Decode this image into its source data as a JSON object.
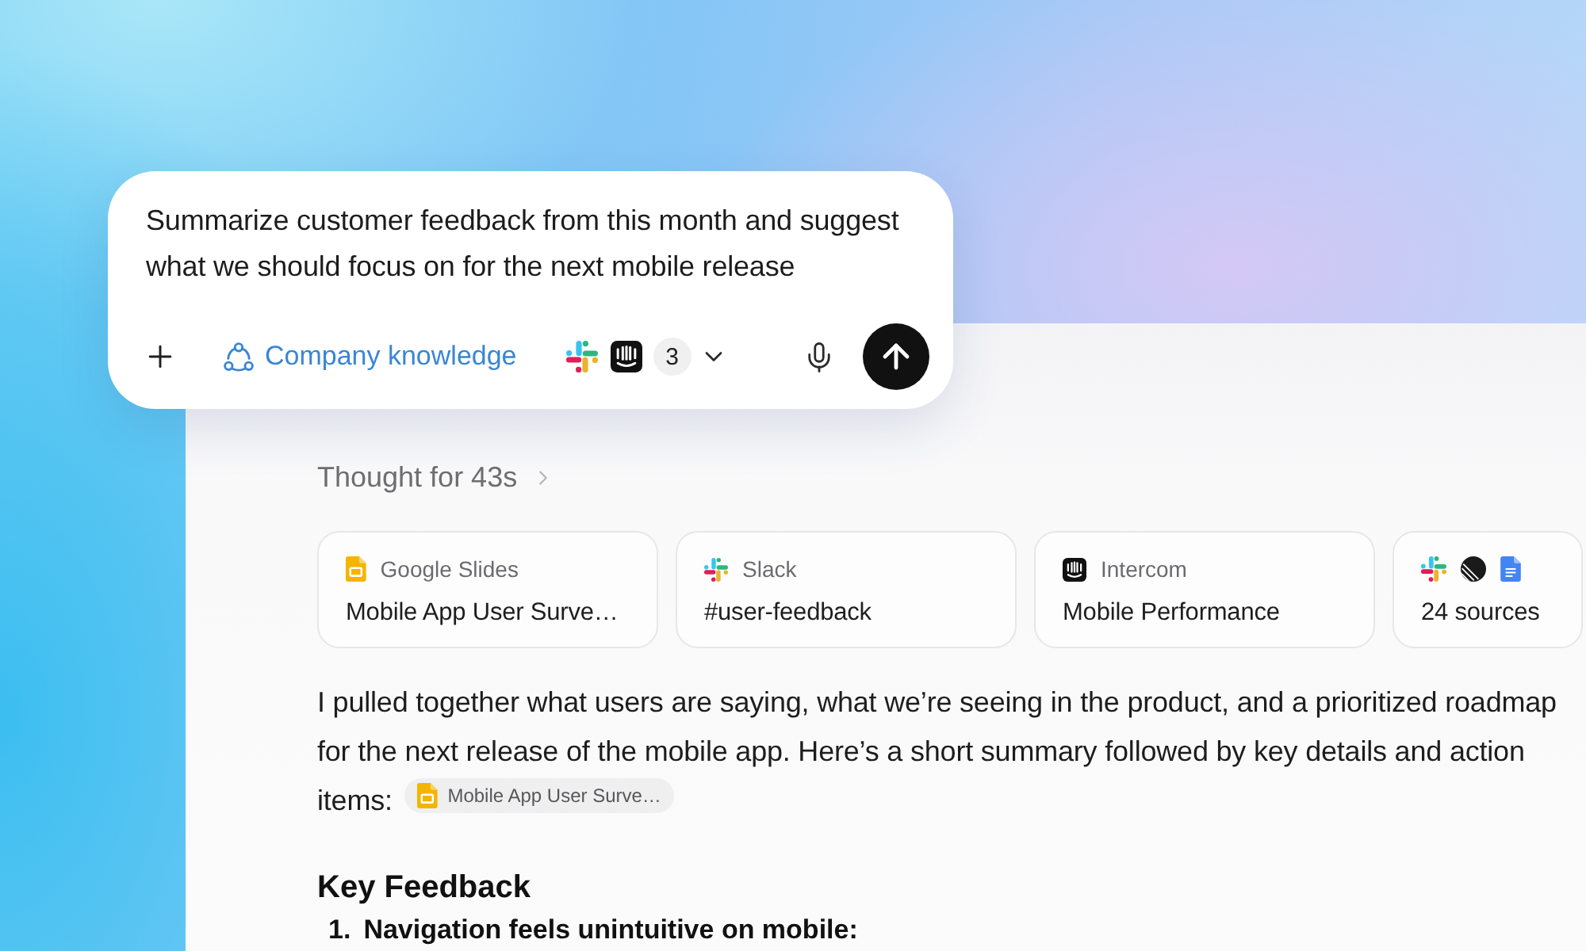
{
  "prompt": {
    "text": "Summarize customer feedback from this month and suggest what we should focus on for the next mobile release",
    "knowledge_label": "Company knowledge",
    "connector_count": "3"
  },
  "response": {
    "thought_label": "Thought for 43s",
    "sources": [
      {
        "kind": "slides",
        "app": "Google Slides",
        "title": "Mobile App User Surve…"
      },
      {
        "kind": "slack",
        "app": "Slack",
        "title": "#user-feedback"
      },
      {
        "kind": "intercom",
        "app": "Intercom",
        "title": "Mobile Performance"
      },
      {
        "kind": "more",
        "title": "24 sources"
      }
    ],
    "paragraph": "I pulled together what users are saying, what we’re seeing in the product, and a prioritized roadmap for the next release of the mobile app. Here’s a short summary followed by key details and action items:",
    "citation": {
      "kind": "slides",
      "label": "Mobile App User Surve…"
    },
    "heading": "Key Feedback",
    "list": [
      {
        "number": "1.",
        "text": "Navigation feels unintuitive on mobile:"
      }
    ]
  }
}
